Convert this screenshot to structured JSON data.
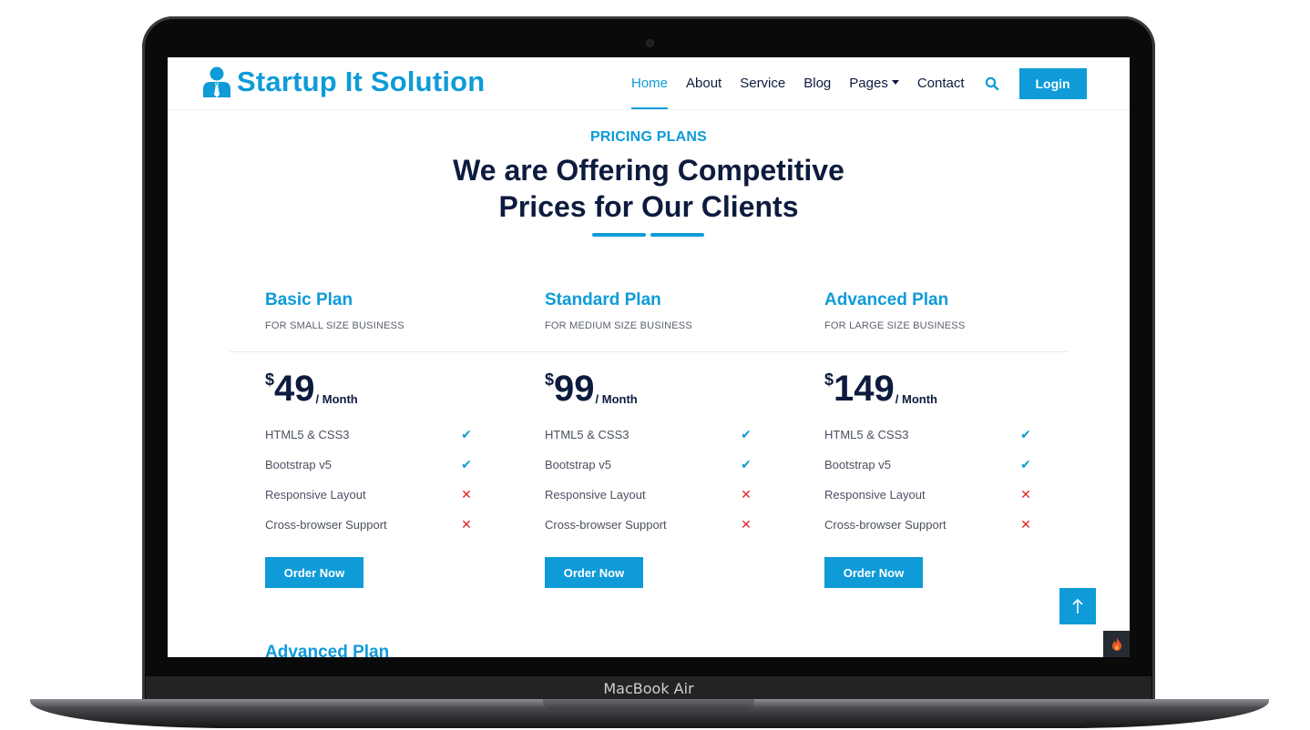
{
  "device": {
    "label": "MacBook Air"
  },
  "brand": {
    "name": "Startup It Solution",
    "color": "#0e9bd8",
    "icon": "user-tie-icon"
  },
  "nav": {
    "items": [
      "Home",
      "About",
      "Service",
      "Blog",
      "Pages",
      "Contact"
    ],
    "active": "Home",
    "search_icon": "search-icon",
    "login_label": "Login"
  },
  "section": {
    "eyebrow": "PRICING PLANS",
    "headline_line1": "We are Offering Competitive",
    "headline_line2": "Prices for Our Clients"
  },
  "plans": [
    {
      "title": "Basic Plan",
      "subtitle": "FOR SMALL SIZE BUSINESS",
      "currency": "$",
      "price": "49",
      "period": "/ Month",
      "features": [
        {
          "label": "HTML5 & CSS3",
          "mark": "✔"
        },
        {
          "label": "Bootstrap v5",
          "mark": "✔"
        },
        {
          "label": "Responsive Layout",
          "mark": "✕"
        },
        {
          "label": "Cross-browser Support",
          "mark": "✕"
        }
      ],
      "cta": "Order Now"
    },
    {
      "title": "Standard Plan",
      "subtitle": "FOR MEDIUM SIZE BUSINESS",
      "currency": "$",
      "price": "99",
      "period": "/ Month",
      "features": [
        {
          "label": "HTML5 & CSS3",
          "mark": "✔"
        },
        {
          "label": "Bootstrap v5",
          "mark": "✔"
        },
        {
          "label": "Responsive Layout",
          "mark": "✕"
        },
        {
          "label": "Cross-browser Support",
          "mark": "✕"
        }
      ],
      "cta": "Order Now"
    },
    {
      "title": "Advanced Plan",
      "subtitle": "FOR LARGE SIZE BUSINESS",
      "currency": "$",
      "price": "149",
      "period": "/ Month",
      "features": [
        {
          "label": "HTML5 & CSS3",
          "mark": "✔"
        },
        {
          "label": "Bootstrap v5",
          "mark": "✔"
        },
        {
          "label": "Responsive Layout",
          "mark": "✕"
        },
        {
          "label": "Cross-browser Support",
          "mark": "✕"
        }
      ],
      "cta": "Order Now"
    }
  ],
  "next_row": {
    "title": "Advanced Plan"
  },
  "colors": {
    "accent": "#0e9bd8",
    "heading": "#0d1b3e",
    "cross": "#e02424"
  }
}
